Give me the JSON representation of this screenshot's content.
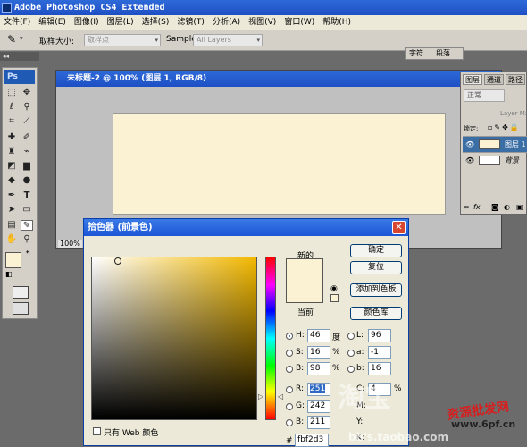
{
  "app": {
    "title": "Adobe Photoshop CS4 Extended"
  },
  "menu": [
    "文件(F)",
    "编辑(E)",
    "图像(I)",
    "图层(L)",
    "选择(S)",
    "滤镜(T)",
    "分析(A)",
    "视图(V)",
    "窗口(W)",
    "帮助(H)"
  ],
  "options": {
    "sample_size_label": "取样大小:",
    "sample_size_value": "取样点",
    "sample_label": "Sample:",
    "sample_value": "All Layers"
  },
  "panels": {
    "char_tab": "字符",
    "para_tab": "段落"
  },
  "tools": {
    "logo": "Ps"
  },
  "document": {
    "title": "未标题-2 @ 100% (图层 1, RGB/8)",
    "zoom": "100%",
    "fill_color": "#fbf2d3"
  },
  "layers": {
    "tabs": [
      "图层",
      "通道",
      "路径"
    ],
    "blend_mode": "正常",
    "opacity_label": "Layer Ma",
    "lock_label": "锁定:",
    "rows": [
      {
        "name": "图层 1",
        "selected": true
      },
      {
        "name": "背景",
        "selected": false
      }
    ],
    "footer": "fx."
  },
  "picker": {
    "title": "拾色器 (前景色)",
    "new_label": "新的",
    "current_label": "当前",
    "buttons": {
      "ok": "确定",
      "reset": "复位",
      "add_swatch": "添加到色板",
      "libraries": "颜色库"
    },
    "hsb": {
      "h_label": "H:",
      "h": "46",
      "h_unit": "度",
      "s_label": "S:",
      "s": "16",
      "s_unit": "%",
      "b_label": "B:",
      "b": "98",
      "b_unit": "%"
    },
    "lab": {
      "l_label": "L:",
      "l": "96",
      "a_label": "a:",
      "a": "-1",
      "b_label": "b:",
      "b": "16"
    },
    "rgb": {
      "r_label": "R:",
      "r": "251",
      "g_label": "G:",
      "g": "242",
      "b_label": "B:",
      "b": "211"
    },
    "cmyk": {
      "c_label": "C:",
      "c": "4",
      "c_unit": "%",
      "m_label": "M:",
      "y_label": "Y:",
      "k_label": "K:"
    },
    "hex_label": "#",
    "hex": "fbf2d3",
    "web_only_label": "只有 Web 颜色",
    "color": "#fbf2d3"
  },
  "watermark": {
    "left": "淘宝",
    "right": "资源批发网",
    "url": "www.6pf.cn",
    "site": "bb's.taobao.com"
  }
}
